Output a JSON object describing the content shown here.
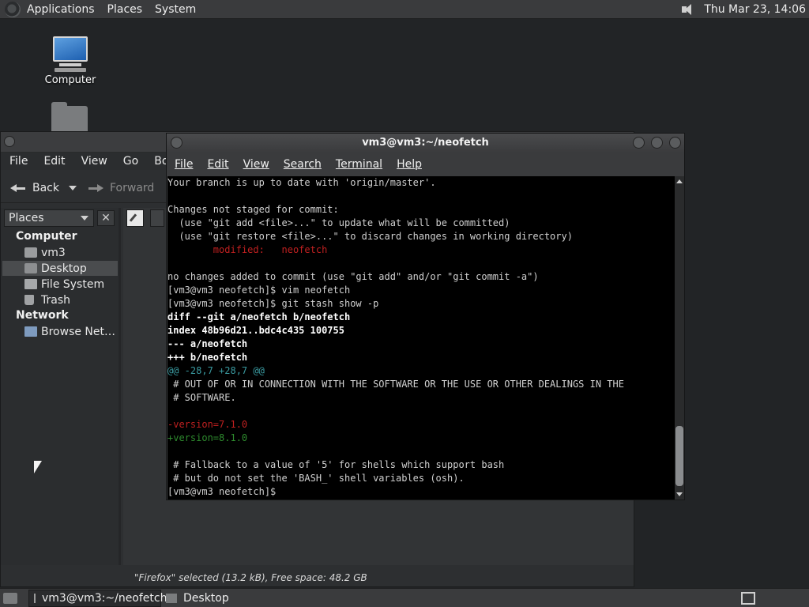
{
  "top_panel": {
    "menus": [
      "Applications",
      "Places",
      "System"
    ],
    "clock": "Thu Mar 23, 14:06"
  },
  "desktop_icons": {
    "computer_label": "Computer"
  },
  "file_manager": {
    "menus": [
      "File",
      "Edit",
      "View",
      "Go",
      "Book"
    ],
    "back_label": "Back",
    "forward_label": "Forward",
    "sidebar": {
      "places_combo": "Places",
      "sections": {
        "computer": "Computer",
        "network": "Network"
      },
      "items": [
        "vm3",
        "Desktop",
        "File System",
        "Trash"
      ],
      "network_items": [
        "Browse Net…"
      ]
    },
    "status": "\"Firefox\" selected (13.2 kB), Free space: 48.2 GB"
  },
  "terminal": {
    "title": "vm3@vm3:~/neofetch",
    "menus": [
      "File",
      "Edit",
      "View",
      "Search",
      "Terminal",
      "Help"
    ],
    "lines": [
      {
        "text": "Your branch is up to date with 'origin/master'.",
        "style": "normal"
      },
      {
        "text": "",
        "style": "normal"
      },
      {
        "text": "Changes not staged for commit:",
        "style": "normal"
      },
      {
        "text": "  (use \"git add <file>...\" to update what will be committed)",
        "style": "normal"
      },
      {
        "text": "  (use \"git restore <file>...\" to discard changes in working directory)",
        "style": "normal"
      },
      {
        "text": "        modified:   neofetch",
        "style": "red"
      },
      {
        "text": "",
        "style": "normal"
      },
      {
        "text": "no changes added to commit (use \"git add\" and/or \"git commit -a\")",
        "style": "normal"
      },
      {
        "text": "[vm3@vm3 neofetch]$ vim neofetch",
        "style": "normal"
      },
      {
        "text": "[vm3@vm3 neofetch]$ git stash show -p",
        "style": "normal"
      },
      {
        "text": "diff --git a/neofetch b/neofetch",
        "style": "bold"
      },
      {
        "text": "index 48b96d21..bdc4c435 100755",
        "style": "bold"
      },
      {
        "text": "--- a/neofetch",
        "style": "bold"
      },
      {
        "text": "+++ b/neofetch",
        "style": "bold"
      },
      {
        "text": "@@ -28,7 +28,7 @@",
        "style": "cyan"
      },
      {
        "text": " # OUT OF OR IN CONNECTION WITH THE SOFTWARE OR THE USE OR OTHER DEALINGS IN THE",
        "style": "normal"
      },
      {
        "text": " # SOFTWARE.",
        "style": "normal"
      },
      {
        "text": "",
        "style": "normal"
      },
      {
        "text": "-version=7.1.0",
        "style": "red"
      },
      {
        "text": "+version=8.1.0",
        "style": "green"
      },
      {
        "text": "",
        "style": "normal"
      },
      {
        "text": " # Fallback to a value of '5' for shells which support bash",
        "style": "normal"
      },
      {
        "text": " # but do not set the 'BASH_' shell variables (osh).",
        "style": "normal"
      },
      {
        "text": "[vm3@vm3 neofetch]$ ",
        "style": "normal"
      }
    ]
  },
  "bottom_panel": {
    "tasks": [
      "vm3@vm3:~/neofetch",
      "Desktop"
    ]
  },
  "colors": {
    "terminal_bg": "#000000",
    "diff_removed": "#c02020",
    "diff_added": "#2e8b2e",
    "diff_hunk": "#3a9aa0"
  }
}
